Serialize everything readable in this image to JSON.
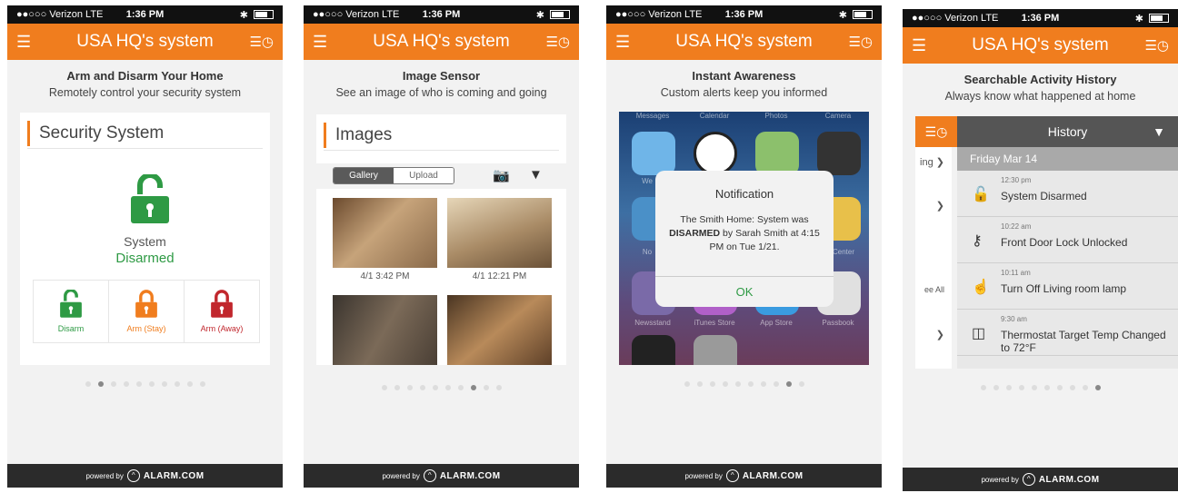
{
  "status_bar": {
    "carrier": "●●○○○ Verizon  LTE",
    "time": "1:36 PM",
    "bluetooth": "✱"
  },
  "app_title": "USA HQ's system",
  "footer": {
    "powered": "powered by",
    "brand": "ALARM.COM"
  },
  "screens": [
    {
      "heading": "Arm and Disarm Your Home",
      "subheading": "Remotely control your security system",
      "card_title": "Security System",
      "system_label": "System",
      "system_state": "Disarmed",
      "buttons": [
        {
          "label": "Disarm",
          "color": "#2e9a44"
        },
        {
          "label": "Arm (Stay)",
          "color": "#f07d1e"
        },
        {
          "label": "Arm (Away)",
          "color": "#c1272d"
        }
      ],
      "active_dot": 1
    },
    {
      "heading": "Image Sensor",
      "subheading": "See an image of who is coming and going",
      "card_title": "Images",
      "tabs": [
        "Gallery",
        "Upload"
      ],
      "images": [
        {
          "caption": "4/1  3:42 PM"
        },
        {
          "caption": "4/1  12:21 PM"
        },
        {
          "caption": ""
        },
        {
          "caption": ""
        }
      ],
      "active_dot": 7
    },
    {
      "heading": "Instant Awareness",
      "subheading": "Custom alerts keep you informed",
      "app_labels": [
        "Messages",
        "Calendar",
        "Photos",
        "Camera",
        "We",
        "No",
        "Center",
        "Newsstand",
        "iTunes Store",
        "App Store",
        "Passbook"
      ],
      "notification": {
        "title": "Notification",
        "body_pre": "The Smith Home: System was ",
        "body_bold": "DISARMED",
        "body_post": " by Sarah Smith at 4:15 PM on Tue 1/21.",
        "ok": "OK"
      },
      "active_dot": 8
    },
    {
      "heading": "Searchable Activity History",
      "subheading": "Always know what happened at home",
      "history_title": "History",
      "date": "Friday Mar 14",
      "side_items": [
        "ing",
        "",
        "ee All",
        ""
      ],
      "events": [
        {
          "time": "12:30 pm",
          "text": "System Disarmed",
          "icon": "unlock-icon"
        },
        {
          "time": "10:22 am",
          "text": "Front Door Lock Unlocked",
          "icon": "key-icon"
        },
        {
          "time": "10:11 am",
          "text": "Turn Off Living room lamp",
          "icon": "hand-icon"
        },
        {
          "time": "9:30 am",
          "text": "Thermostat Target Temp Changed to 72°F",
          "icon": "thermostat-icon"
        }
      ],
      "active_dot": 9
    }
  ]
}
